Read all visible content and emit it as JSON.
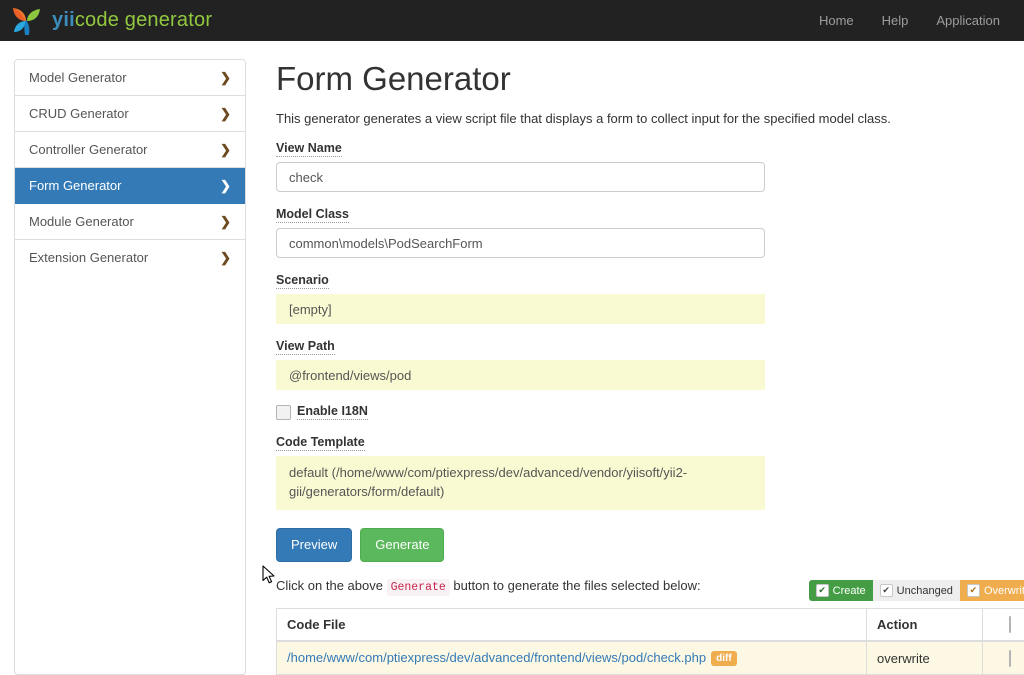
{
  "navbar": {
    "brand_primary": "yii",
    "brand_secondary": "code generator",
    "links": [
      {
        "label": "Home"
      },
      {
        "label": "Help"
      },
      {
        "label": "Application"
      }
    ]
  },
  "sidebar": {
    "items": [
      {
        "label": "Model Generator",
        "active": false
      },
      {
        "label": "CRUD Generator",
        "active": false
      },
      {
        "label": "Controller Generator",
        "active": false
      },
      {
        "label": "Form Generator",
        "active": true
      },
      {
        "label": "Module Generator",
        "active": false
      },
      {
        "label": "Extension Generator",
        "active": false
      }
    ],
    "chevron": "❯"
  },
  "main": {
    "title": "Form Generator",
    "description": "This generator generates a view script file that displays a form to collect input for the specified model class.",
    "fields": {
      "view_name": {
        "label": "View Name",
        "value": "check"
      },
      "model_class": {
        "label": "Model Class",
        "value": "common\\models\\PodSearchForm"
      },
      "scenario": {
        "label": "Scenario",
        "value": "[empty]"
      },
      "view_path": {
        "label": "View Path",
        "value": "@frontend/views/pod"
      },
      "enable_i18n": {
        "label": "Enable I18N",
        "checked": false
      },
      "code_template": {
        "label": "Code Template",
        "value": "default (/home/www/com/ptiexpress/dev/advanced/vendor/yiisoft/yii2-gii/generators/form/default)"
      }
    },
    "buttons": {
      "preview": "Preview",
      "generate": "Generate"
    }
  },
  "results": {
    "hint_before": "Click on the above",
    "hint_code": "Generate",
    "hint_after": "button to generate the files selected below:",
    "legend": [
      {
        "label": "Create",
        "checked": true,
        "color": "#449d44"
      },
      {
        "label": "Unchanged",
        "checked": true,
        "color": "#eeeeee"
      },
      {
        "label": "Overwrite",
        "checked": true,
        "color": "#f0ad4e"
      }
    ],
    "check_glyph": "✔",
    "columns": {
      "code_file": "Code File",
      "action": "Action"
    },
    "header_checkbox": {
      "checked": false
    },
    "rows": [
      {
        "file": "/home/www/com/ptiexpress/dev/advanced/frontend/views/pod/check.php",
        "badge": "diff",
        "action": "overwrite",
        "checked": false
      }
    ]
  },
  "colors": {
    "accent_blue": "#337ab7",
    "success_green": "#5cb85c",
    "warning_orange": "#f0ad4e",
    "navbar_dark": "#222222",
    "autofill_yellow": "#fafad2",
    "row_highlight": "#fcf8e3"
  }
}
